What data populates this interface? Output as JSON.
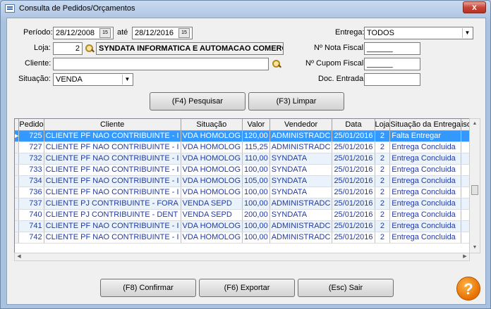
{
  "window": {
    "title": "Consulta de Pedidos/Orçamentos",
    "close_glyph": "x"
  },
  "filters": {
    "periodo_label": "Período:",
    "periodo_de": "28/12/2008",
    "ate_label": "até",
    "periodo_ate": "28/12/2016",
    "calendar_label": "15",
    "loja_label": "Loja:",
    "loja_value": "2",
    "loja_nome": "SYNDATA INFORMATICA E AUTOMACAO COMERCIAL",
    "cliente_label": "Cliente:",
    "cliente_value": "",
    "situacao_label": "Situação:",
    "situacao_value": "VENDA",
    "entrega_label": "Entrega:",
    "entrega_value": "TODOS",
    "nota_fiscal_label": "Nº Nota Fiscal:",
    "nota_fiscal_value": "______",
    "cupom_fiscal_label": "Nº Cupom Fiscal:",
    "cupom_fiscal_value": "______",
    "doc_entrada_label": "Doc. Entrada:",
    "doc_entrada_value": ""
  },
  "actions": {
    "pesquisar": "(F4) Pesquisar",
    "limpar": "(F3) Limpar",
    "confirmar": "(F8) Confirmar",
    "exportar": "(F6) Exportar",
    "sair": "(Esc) Sair",
    "help": "?"
  },
  "grid": {
    "columns": [
      "Pedido",
      "Cliente",
      "Situação",
      "Valor",
      "Vendedor",
      "Data",
      "Loja",
      "Situação da Entrega",
      "iso"
    ],
    "rows": [
      [
        "725",
        "CLIENTE PF NAO CONTRIBUINTE - I",
        "VDA HOMOLOG",
        "120,00",
        "ADMINISTRADC",
        "25/01/2016",
        "2",
        "Falta Entregar"
      ],
      [
        "727",
        "CLIENTE PF NAO CONTRIBUINTE - I",
        "VDA HOMOLOG",
        "115,25",
        "ADMINISTRADC",
        "25/01/2016",
        "2",
        "Entrega Concluida"
      ],
      [
        "732",
        "CLIENTE PF NAO CONTRIBUINTE - I",
        "VDA HOMOLOG",
        "110,00",
        "SYNDATA",
        "25/01/2016",
        "2",
        "Entrega Concluida"
      ],
      [
        "733",
        "CLIENTE PF NAO CONTRIBUINTE - I",
        "VDA HOMOLOG",
        "100,00",
        "SYNDATA",
        "25/01/2016",
        "2",
        "Entrega Concluida"
      ],
      [
        "734",
        "CLIENTE PF NAO CONTRIBUINTE - I",
        "VDA HOMOLOG",
        "105,00",
        "SYNDATA",
        "25/01/2016",
        "2",
        "Entrega Concluida"
      ],
      [
        "736",
        "CLIENTE PF NAO CONTRIBUINTE - I",
        "VDA HOMOLOG",
        "100,00",
        "SYNDATA",
        "25/01/2016",
        "2",
        "Entrega Concluida"
      ],
      [
        "737",
        "CLIENTE PJ CONTRIBUINTE - FORA",
        "VENDA SEPD",
        "100,00",
        "ADMINISTRADC",
        "25/01/2016",
        "2",
        "Entrega Concluida"
      ],
      [
        "740",
        "CLIENTE PJ CONTRIBUINTE - DENT",
        "VENDA SEPD",
        "200,00",
        "SYNDATA",
        "25/01/2016",
        "2",
        "Entrega Concluida"
      ],
      [
        "741",
        "CLIENTE PF NAO CONTRIBUINTE - I",
        "VDA HOMOLOG",
        "100,00",
        "ADMINISTRADC",
        "25/01/2016",
        "2",
        "Entrega Concluida"
      ],
      [
        "742",
        "CLIENTE PF NAO CONTRIBUINTE - I",
        "VDA HOMOLOG",
        "100,00",
        "ADMINISTRADC",
        "25/01/2016",
        "2",
        "Entrega Concluida"
      ]
    ]
  }
}
